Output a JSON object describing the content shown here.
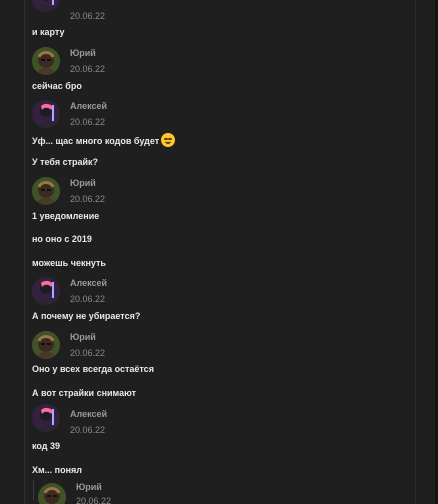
{
  "chat": {
    "messages": {
      "top_partial": {
        "time": "20.06.22",
        "text": "и карту"
      },
      "m1": {
        "author": "Юрий",
        "time": "20.06.22",
        "text": "сейчас бро"
      },
      "m2": {
        "author": "Алексей",
        "time": "20.06.22",
        "text": "Уф... щас много кодов будет",
        "text2": "У тебя страйк?"
      },
      "m3": {
        "author": "Юрий",
        "time": "20.06.22",
        "text": "1 уведомление",
        "text2": "но оно с 2019",
        "text3": "можешь чекнуть"
      },
      "m4": {
        "author": "Алексей",
        "time": "20.06.22",
        "text": "А почему не убирается?"
      },
      "m5": {
        "author": "Юрий",
        "time": "20.06.22",
        "text": "Оно у всех всегда остаётся",
        "text2": "А вот страйки снимают"
      },
      "m6": {
        "author": "Алексей",
        "time": "20.06.22",
        "text": "код 39",
        "text2": "Хм... понял"
      },
      "bottom_partial": {
        "author": "Юрий",
        "time": "20.06.22"
      }
    }
  },
  "icons": {
    "emoji": "smiling-face-emoji",
    "avatar_yuri": "avatar-icon",
    "avatar_alexey": "avatar-icon"
  },
  "colors": {
    "background": "#1f1f1f",
    "name_gray": "#9a9a9a",
    "timestamp_gray": "#8a8a8a",
    "message_text": "#e9e9e9",
    "emoji_yellow": "#ffc72f"
  }
}
